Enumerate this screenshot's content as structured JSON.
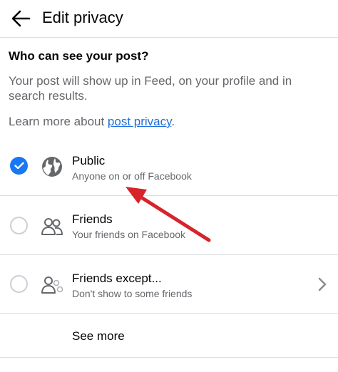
{
  "header": {
    "title": "Edit privacy",
    "back_icon": "arrow-left-icon"
  },
  "intro": {
    "question": "Who can see your post?",
    "description": "Your post will show up in Feed, on your profile and in search results.",
    "learn_more_prefix": "Learn more about ",
    "learn_more_link": "post privacy",
    "learn_more_suffix": "."
  },
  "options": [
    {
      "label": "Public",
      "subtitle": "Anyone on or off Facebook",
      "selected": true,
      "icon": "globe-icon"
    },
    {
      "label": "Friends",
      "subtitle": "Your friends on Facebook",
      "selected": false,
      "icon": "friends-icon"
    },
    {
      "label": "Friends except...",
      "subtitle": "Don't show to some friends",
      "selected": false,
      "icon": "friends-except-icon",
      "has_chevron": true
    }
  ],
  "see_more_label": "See more",
  "colors": {
    "accent": "#1877f2",
    "link": "#216fdb",
    "secondary_text": "#65676b",
    "annotation_arrow": "#d8232a"
  }
}
